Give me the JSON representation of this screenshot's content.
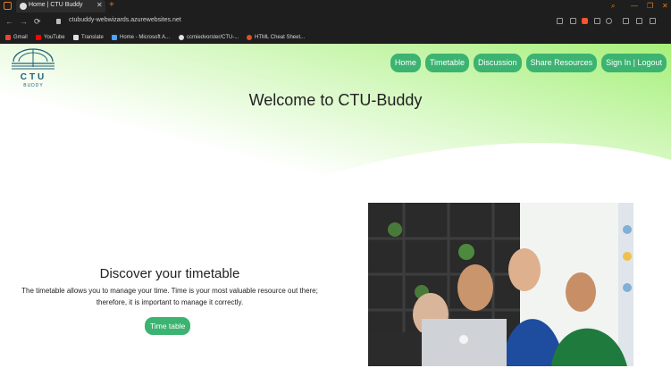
{
  "browser": {
    "tab_title": "Home | CTU Buddy",
    "tab_close": "✕",
    "new_tab": "+",
    "url": "ctubuddy-webwizards.azurewebsites.net",
    "window_controls": [
      "⌕",
      "—",
      "❐",
      "✕"
    ],
    "nav": {
      "back": "←",
      "forward": "→",
      "reload": "⟳"
    },
    "bookmarks": [
      {
        "label": "Gmail",
        "color": "#ea4335"
      },
      {
        "label": "YouTube",
        "color": "#ff0000"
      },
      {
        "label": "Translate",
        "color": "#e0e0e0"
      },
      {
        "label": "Home - Microsoft A...",
        "color": "#4aa3ff"
      },
      {
        "label": "ccmiedvorster/CTU-...",
        "color": "#e0e0e0"
      },
      {
        "label": "HTML Cheat Sheet...",
        "color": "#e34f26"
      }
    ]
  },
  "logo": {
    "name": "CTU",
    "sub": "BUDDY"
  },
  "nav": {
    "items": [
      "Home",
      "Timetable",
      "Discussion",
      "Share Resources",
      "Sign In | Logout"
    ]
  },
  "hero": {
    "title": "Welcome to CTU-Buddy"
  },
  "section": {
    "title": "Discover your timetable",
    "text": "The timetable allows you to manage your time. Time is your most valuable resource out there; therefore, it is important to manage it correctly.",
    "button": "Time table"
  },
  "colors": {
    "accent": "#3cb371",
    "hero_gradient_end": "#a6f07a",
    "logo_blue": "#1f5f7a"
  }
}
